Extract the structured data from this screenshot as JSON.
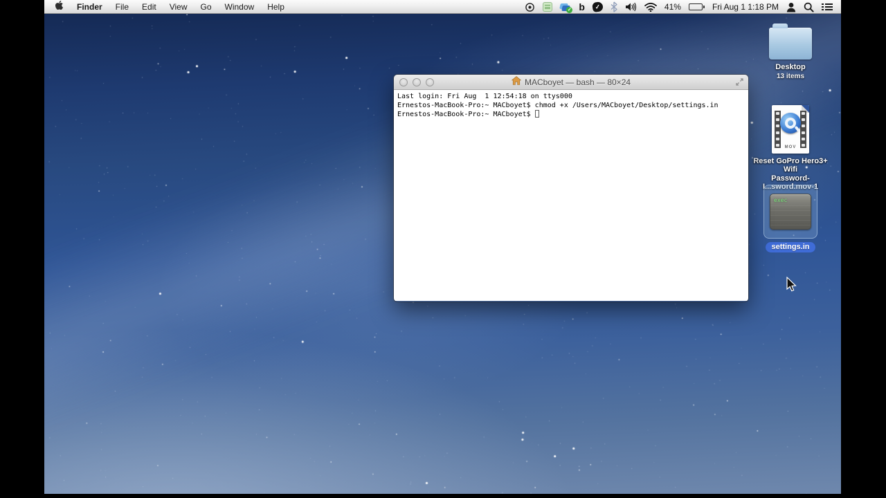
{
  "menubar": {
    "items": [
      "Finder",
      "File",
      "Edit",
      "View",
      "Go",
      "Window",
      "Help"
    ],
    "status": {
      "battery_percent": "41%",
      "clock": "Fri Aug 1  1:18 PM",
      "b_glyph": "b"
    }
  },
  "terminal": {
    "title": "MACboyet — bash — 80×24",
    "lines": [
      "Last login: Fri Aug  1 12:54:18 on ttys000",
      "Ernestos-MacBook-Pro:~ MACboyet$ chmod +x /Users/MACboyet/Desktop/settings.in",
      "Ernestos-MacBook-Pro:~ MACboyet$ "
    ]
  },
  "desktop": {
    "icons": [
      {
        "type": "folder",
        "label": "Desktop",
        "sublabel": "13 items"
      },
      {
        "type": "quicktime-mov",
        "label_line1": "Reset GoPro Hero3+ Wifi",
        "label_line2": "Password-I...sword.mov-1",
        "badge": "MOV"
      },
      {
        "type": "unix-executable",
        "label": "settings.in",
        "badge": "exec",
        "selected": true
      }
    ]
  },
  "colors": {
    "selected_label_pill": "#3f6cd7",
    "folder_blue": "#a9c9e2",
    "wallpaper_top": "#152a55",
    "wallpaper_bottom": "#6f88ad",
    "menubar_bg": "#efefef"
  }
}
